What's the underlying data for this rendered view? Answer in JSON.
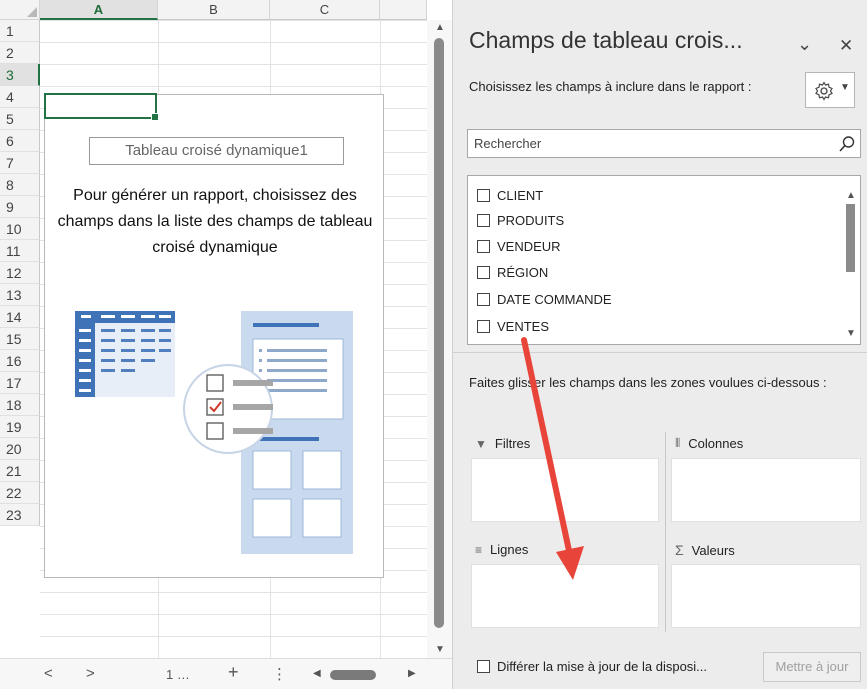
{
  "sheet": {
    "columns": [
      "A",
      "B",
      "C"
    ],
    "rows": [
      "1",
      "2",
      "3",
      "4",
      "5",
      "6",
      "7",
      "8",
      "9",
      "10",
      "11",
      "12",
      "13",
      "14",
      "15",
      "16",
      "17",
      "18",
      "19",
      "20",
      "21",
      "22",
      "23"
    ],
    "selected_column": "A",
    "selected_row": "3",
    "pivot_name": "Tableau croisé dynamique1",
    "pivot_message": "Pour générer un rapport, choisissez des champs dans la liste des champs de tableau croisé dynamique",
    "nav": {
      "prev": "<",
      "next": ">",
      "sheet_tab": "1 …",
      "add": "+",
      "more": "⋮"
    }
  },
  "pane": {
    "title": "Champs de tableau crois...",
    "subtitle": "Choisissez les champs à inclure dans le rapport :",
    "search_placeholder": "Rechercher",
    "fields": [
      {
        "label": "CLIENT",
        "checked": false
      },
      {
        "label": "PRODUITS",
        "checked": false
      },
      {
        "label": "VENDEUR",
        "checked": false
      },
      {
        "label": "RÉGION",
        "checked": false
      },
      {
        "label": "DATE COMMANDE",
        "checked": false
      },
      {
        "label": "VENTES",
        "checked": false
      }
    ],
    "drag_hint": "Faites glisser les champs dans les zones voulues ci-dessous :",
    "zones": {
      "filters": "Filtres",
      "columns": "Colonnes",
      "rows": "Lignes",
      "values": "Valeurs"
    },
    "defer_label": "Différer la mise à jour de la disposi...",
    "update_button": "Mettre à jour"
  },
  "colors": {
    "excel_green": "#217346",
    "annotation_arrow": "#e8443a"
  }
}
